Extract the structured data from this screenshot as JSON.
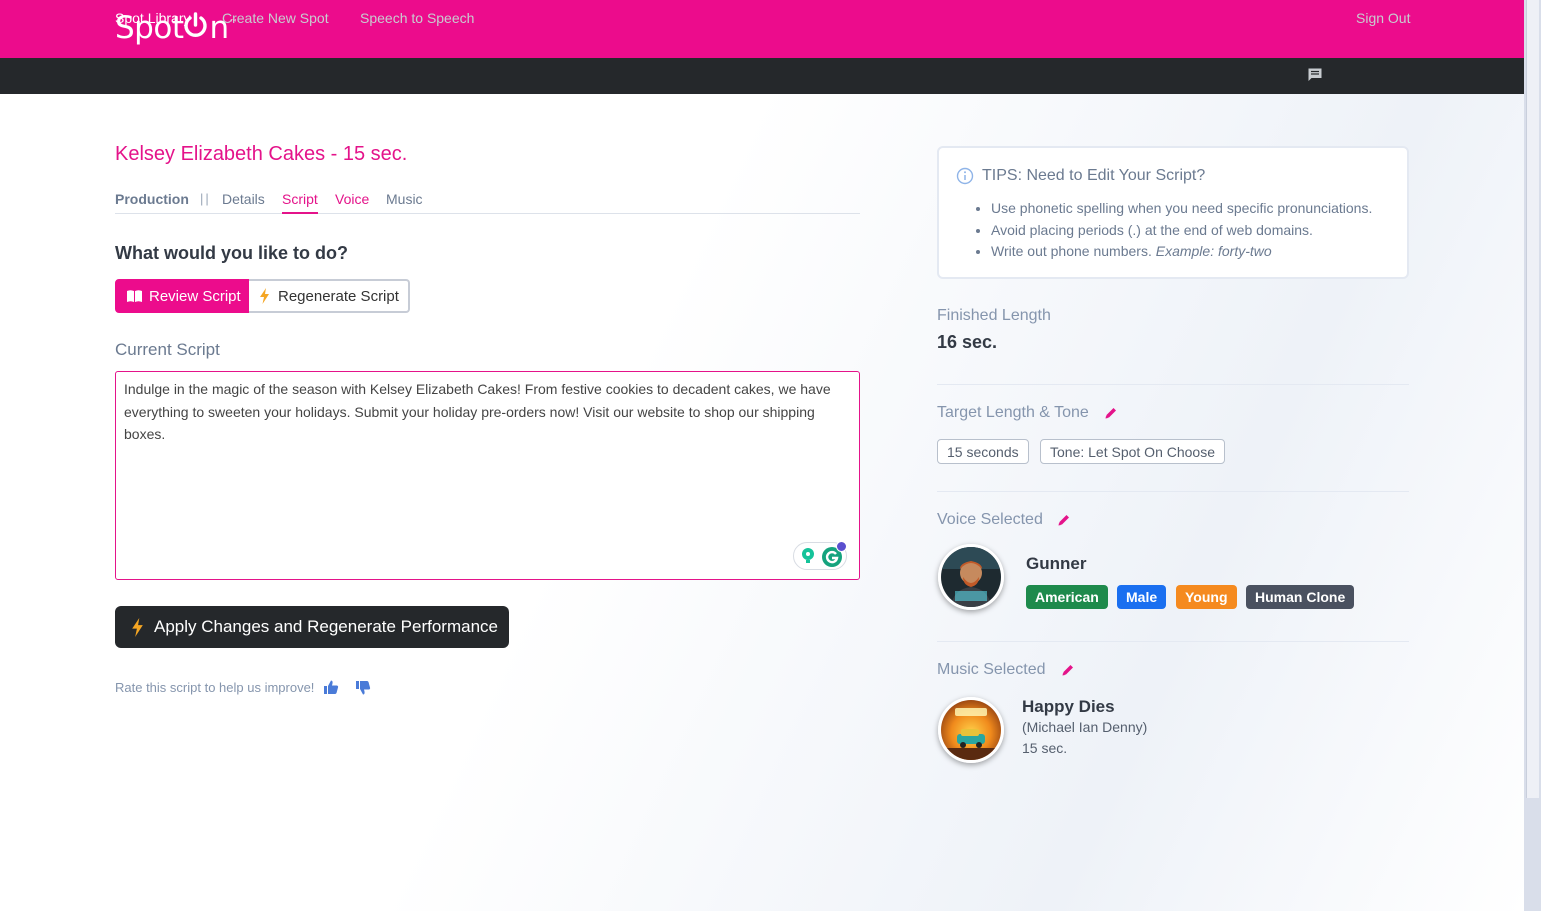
{
  "brand": {
    "name": "Spot",
    "tm": "™",
    "color": "#ec0c8c"
  },
  "nav": {
    "items": [
      {
        "label": "Spot Library"
      },
      {
        "label": "Create New Spot"
      },
      {
        "label": "Speech to Speech"
      }
    ],
    "signout": "Sign Out"
  },
  "page": {
    "title": "Kelsey Elizabeth Cakes - 15 sec.",
    "tabs": {
      "production": "Production",
      "separator": "||",
      "details": "Details",
      "script": "Script",
      "voice": "Voice",
      "music": "Music"
    },
    "question": "What would you like to do?",
    "review_label": "Review Script",
    "regenerate_label": "Regenerate Script",
    "current_script_label": "Current Script",
    "script_text": "Indulge in the magic of the season with Kelsey Elizabeth Cakes! From festive cookies to decadent cakes, we have everything to sweeten your holidays. Submit your holiday pre-orders now! Visit our website to shop our shipping boxes.",
    "apply_label": "Apply Changes and Regenerate Performance",
    "rate_label": "Rate this script to help us improve!"
  },
  "tips": {
    "title": "TIPS: Need to Edit Your Script?",
    "items": [
      "Use phonetic spelling when you need specific pronunciations.",
      "Avoid placing periods (.) at the end of web domains.",
      "Write out phone numbers."
    ],
    "example_prefix": "Example:",
    "example_value": "forty-two"
  },
  "finished": {
    "label": "Finished Length",
    "value": "16 sec."
  },
  "target": {
    "label": "Target Length & Tone",
    "length": "15 seconds",
    "tone": "Tone: Let Spot On Choose"
  },
  "voice": {
    "label": "Voice Selected",
    "name": "Gunner",
    "badges": [
      {
        "text": "American",
        "color": "#1e8a4c"
      },
      {
        "text": "Male",
        "color": "#1a6ff0"
      },
      {
        "text": "Young",
        "color": "#f58a1f"
      },
      {
        "text": "Human Clone",
        "color": "#4a5160"
      }
    ]
  },
  "music": {
    "label": "Music Selected",
    "name": "Happy Dies",
    "artist": "(Michael Ian Denny)",
    "length": "15 sec."
  }
}
